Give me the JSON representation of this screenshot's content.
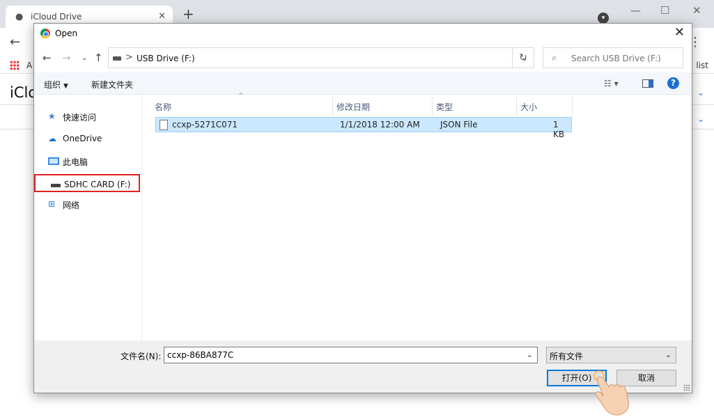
{
  "browser": {
    "tab_title": "iCloud Drive",
    "tab_close": "✕",
    "new_tab": "+",
    "bookmark_apps_letter": "A",
    "bookmark_right": "list",
    "page_heading": "iClo"
  },
  "dialog": {
    "title": "Open",
    "close_glyph": "✕",
    "address": {
      "path": "USB Drive (F:)",
      "separator": ">"
    },
    "search": {
      "placeholder": "Search USB Drive (F:)"
    },
    "commands": {
      "organize": "组织",
      "new_folder": "新建文件夹"
    },
    "nav_items": [
      {
        "label": "快速访问",
        "icon": "star-icon"
      },
      {
        "label": "OneDrive",
        "icon": "cloud-icon"
      },
      {
        "label": "此电脑",
        "icon": "computer-icon"
      },
      {
        "label": "SDHC CARD (F:)",
        "icon": "drive-icon",
        "selected": true
      },
      {
        "label": "网络",
        "icon": "network-icon"
      }
    ],
    "columns": {
      "name": "名称",
      "date": "修改日期",
      "type": "类型",
      "size": "大小"
    },
    "files": [
      {
        "name": "ccxp-5271C071",
        "date": "1/1/2018 12:00 AM",
        "type": "JSON File",
        "size": "1 KB"
      }
    ],
    "filename_label": "文件名(N):",
    "filename_value": "ccxp-86BA877C",
    "filter_value": "所有文件",
    "open_button": "打开(O)",
    "cancel_button": "取消"
  },
  "colors": {
    "accent": "#0078d7",
    "selection": "#cce8ff",
    "highlight_box": "#e02020"
  }
}
